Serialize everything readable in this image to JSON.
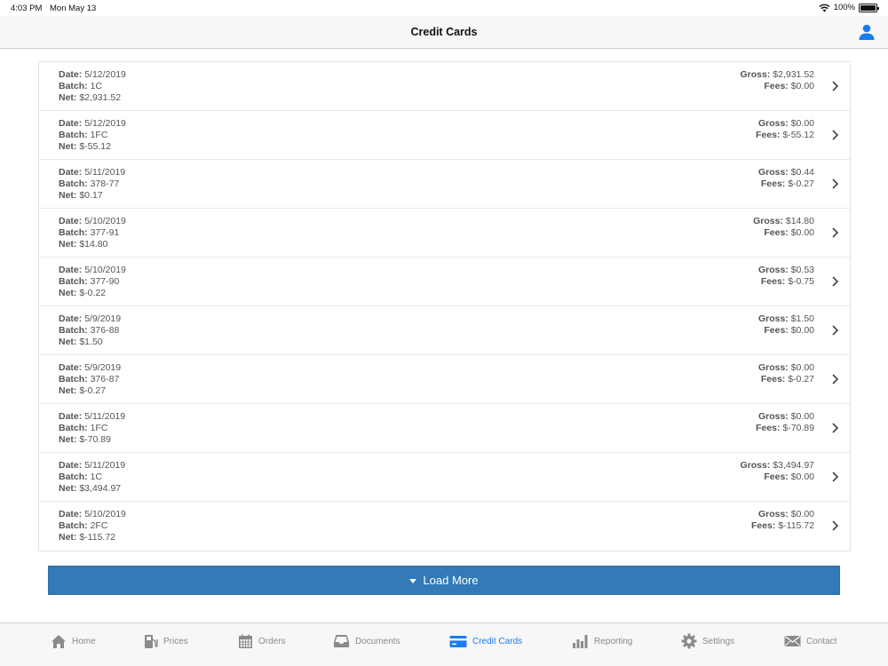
{
  "status_bar": {
    "time": "4:03 PM",
    "date": "Mon May 13",
    "battery": "100%"
  },
  "nav": {
    "title": "Credit Cards"
  },
  "labels": {
    "date": "Date:",
    "batch": "Batch:",
    "net": "Net:",
    "gross": "Gross:",
    "fees": "Fees:"
  },
  "rows": [
    {
      "date": "5/12/2019",
      "batch": "1C",
      "net": "$2,931.52",
      "gross": "$2,931.52",
      "fees": "$0.00"
    },
    {
      "date": "5/12/2019",
      "batch": "1FC",
      "net": "$-55.12",
      "gross": "$0.00",
      "fees": "$-55.12"
    },
    {
      "date": "5/11/2019",
      "batch": "378-77",
      "net": "$0.17",
      "gross": "$0.44",
      "fees": "$-0.27"
    },
    {
      "date": "5/10/2019",
      "batch": "377-91",
      "net": "$14.80",
      "gross": "$14.80",
      "fees": "$0.00"
    },
    {
      "date": "5/10/2019",
      "batch": "377-90",
      "net": "$-0.22",
      "gross": "$0.53",
      "fees": "$-0.75"
    },
    {
      "date": "5/9/2019",
      "batch": "376-88",
      "net": "$1.50",
      "gross": "$1.50",
      "fees": "$0.00"
    },
    {
      "date": "5/9/2019",
      "batch": "376-87",
      "net": "$-0.27",
      "gross": "$0.00",
      "fees": "$-0.27"
    },
    {
      "date": "5/11/2019",
      "batch": "1FC",
      "net": "$-70.89",
      "gross": "$0.00",
      "fees": "$-70.89"
    },
    {
      "date": "5/11/2019",
      "batch": "1C",
      "net": "$3,494.97",
      "gross": "$3,494.97",
      "fees": "$0.00"
    },
    {
      "date": "5/10/2019",
      "batch": "2FC",
      "net": "$-115.72",
      "gross": "$0.00",
      "fees": "$-115.72"
    }
  ],
  "load_more": {
    "label": "Load More"
  },
  "tabs": [
    {
      "label": "Home",
      "icon": "home-icon"
    },
    {
      "label": "Prices",
      "icon": "fuel-pump-icon"
    },
    {
      "label": "Orders",
      "icon": "calendar-icon"
    },
    {
      "label": "Documents",
      "icon": "inbox-tray-icon"
    },
    {
      "label": "Credit Cards",
      "icon": "credit-card-icon",
      "active": true
    },
    {
      "label": "Reporting",
      "icon": "bar-chart-icon"
    },
    {
      "label": "Settings",
      "icon": "gear-icon"
    },
    {
      "label": "Contact",
      "icon": "envelope-icon"
    }
  ],
  "colors": {
    "accent": "#1a7cf0",
    "button": "#337ab7",
    "inactive": "#8a8a8a"
  }
}
